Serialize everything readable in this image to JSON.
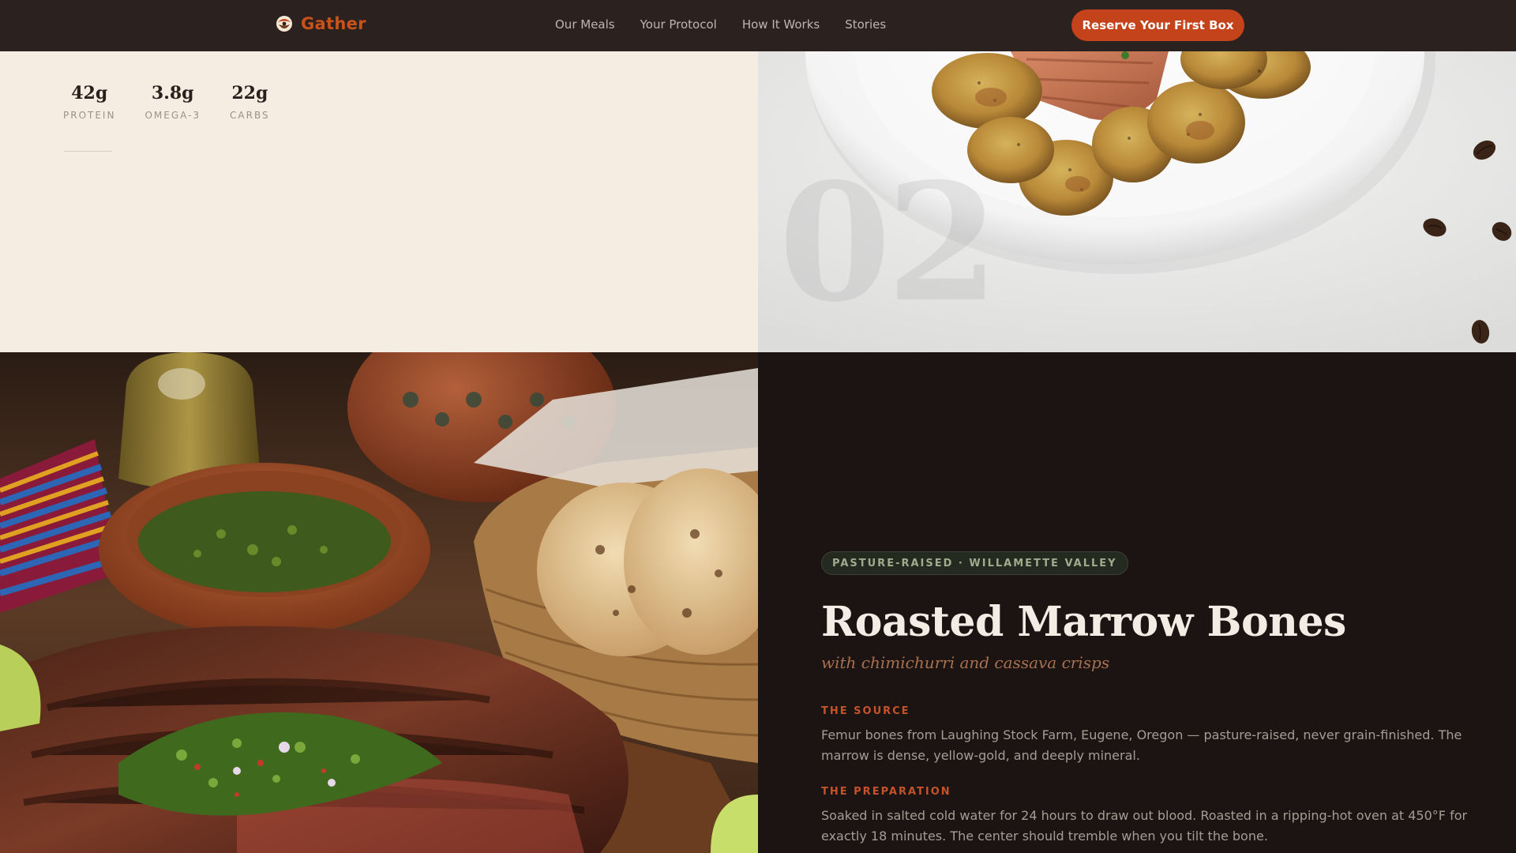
{
  "nav": {
    "brand": "Gather",
    "links": [
      "Our Meals",
      "Your Protocol",
      "How It Works",
      "Stories"
    ],
    "cta": "Reserve Your First Box"
  },
  "macros": [
    {
      "value": "42g",
      "label": "PROTEIN"
    },
    {
      "value": "3.8g",
      "label": "OMEGA-3"
    },
    {
      "value": "22g",
      "label": "CARBS"
    }
  ],
  "meal_number": "02",
  "meal": {
    "badge": "PASTURE-RAISED · WILLAMETTE VALLEY",
    "title": "Roasted Marrow Bones",
    "subtitle": "with chimichurri and cassava crisps",
    "source_heading": "THE SOURCE",
    "source_body": "Femur bones from Laughing Stock Farm, Eugene, Oregon — pasture-raised, never grain-finished. The marrow is dense, yellow-gold, and deeply mineral.",
    "prep_heading": "THE PREPARATION",
    "prep_body": "Soaked in salted cold water for 24 hours to draw out blood. Roasted in a ripping-hot oven at 450°F for exactly 18 minutes. The center should tremble when you tilt the bone."
  },
  "colors": {
    "accent": "#c4431a",
    "nav_bg": "#2b2220",
    "cream": "#f5ede1",
    "dark": "#1c1313"
  }
}
